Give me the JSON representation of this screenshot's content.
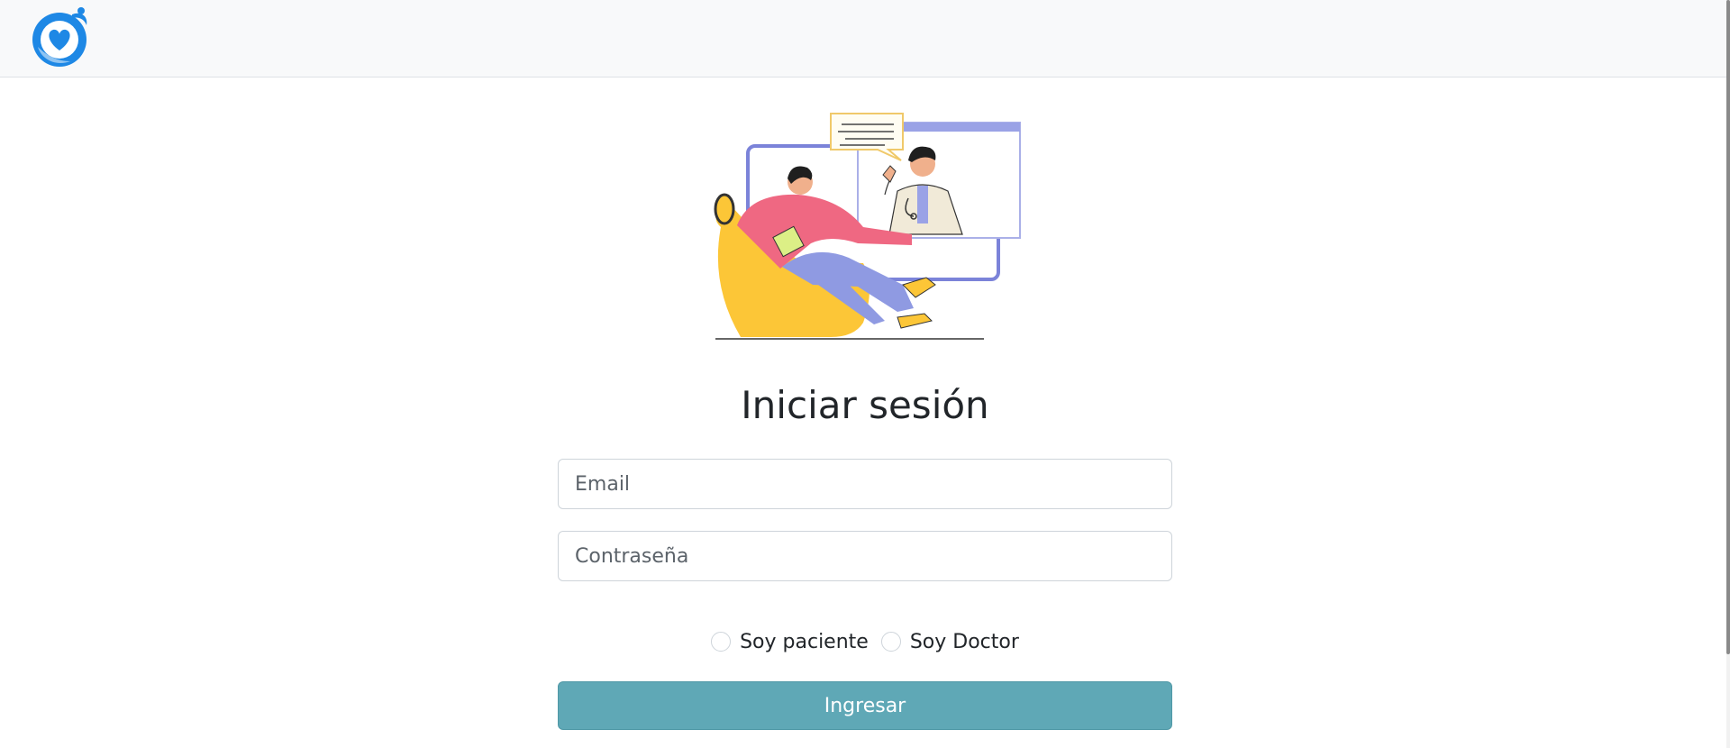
{
  "navbar": {
    "logo_icon": "heart-hands-logo-icon"
  },
  "illustration": {
    "icon": "telemedicine-consultation-illustration"
  },
  "login": {
    "title": "Iniciar sesión",
    "email_placeholder": "Email",
    "password_placeholder": "Contraseña",
    "role_options": [
      "Soy paciente",
      "Soy Doctor"
    ],
    "submit_label": "Ingresar"
  },
  "colors": {
    "brand_blue": "#1e88e5",
    "button_teal": "#5fa8b6",
    "navbar_bg": "#f8f9fa"
  }
}
